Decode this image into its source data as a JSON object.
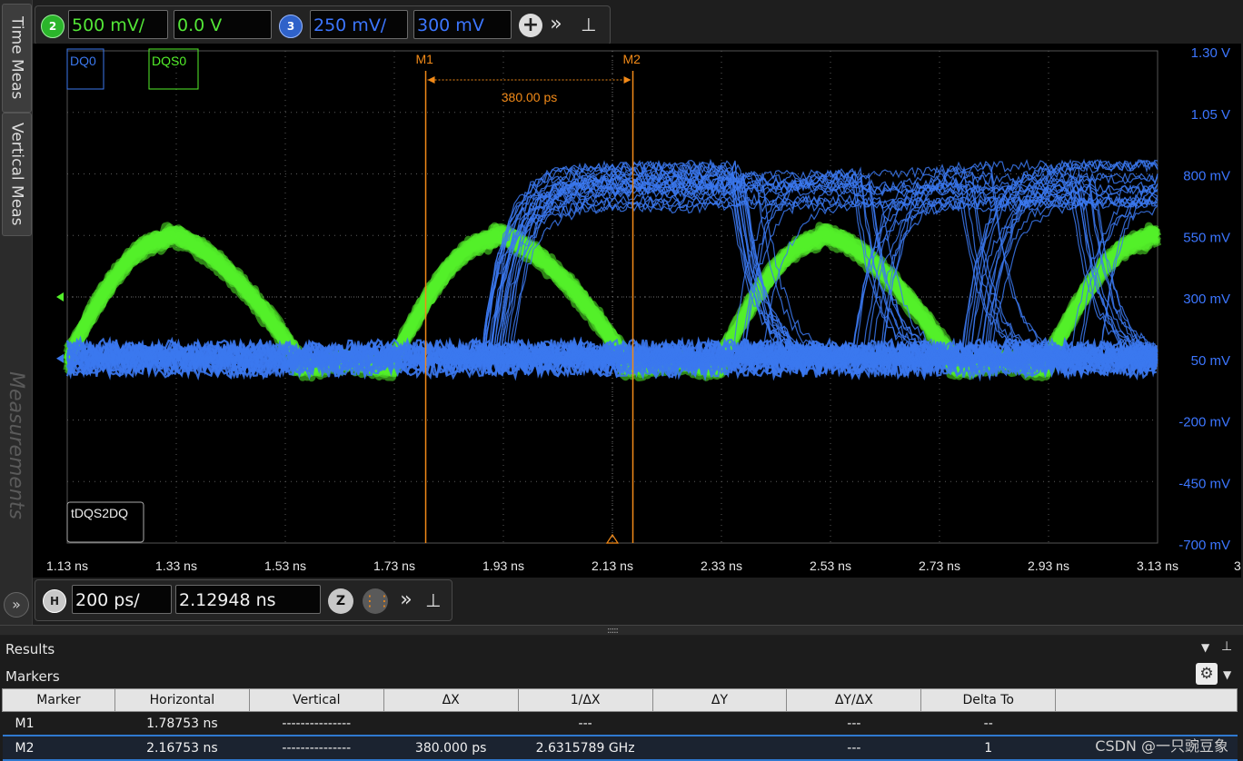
{
  "left_tabs": [
    "Time Meas",
    "Vertical Meas",
    "Measurements"
  ],
  "channel_toolbar": {
    "ch2_badge": "2",
    "ch2_scale": "500 mV/",
    "ch2_offset": "0.0 V",
    "ch3_badge": "3",
    "ch3_scale": "250 mV/",
    "ch3_offset": "300 mV"
  },
  "timebase_toolbar": {
    "h_badge": "H",
    "scale": "200 ps/",
    "position": "2.12948 ns"
  },
  "chart_data": {
    "type": "line",
    "title": "",
    "traces": [
      {
        "name": "DQ0",
        "color": "#3b78ee"
      },
      {
        "name": "DQS0",
        "color": "#53f02a"
      }
    ],
    "x_tick_labels": [
      "1.13 ns",
      "1.33 ns",
      "1.53 ns",
      "1.73 ns",
      "1.93 ns",
      "2.13 ns",
      "2.33 ns",
      "2.53 ns",
      "2.73 ns",
      "2.93 ns",
      "3.13 ns",
      "3"
    ],
    "y_tick_labels": [
      "1.30 V",
      "1.05 V",
      "800 mV",
      "550 mV",
      "300 mV",
      "50 mV",
      "-200 mV",
      "-450 mV",
      "-700 mV"
    ],
    "xlim_ns": [
      1.13,
      3.13
    ],
    "ylim_mV": [
      -700,
      1300
    ],
    "dqs0_crossings_ns": [
      1.13,
      1.55,
      1.73,
      2.15,
      2.33,
      2.75,
      2.93
    ],
    "dqs0_high_level_mV": 550,
    "dqs0_low_level_mV": 50,
    "dq0_baseline_mV": 50,
    "dq0_high_level_mV": 750,
    "markers": [
      {
        "name": "M1",
        "x_ns": 1.78753
      },
      {
        "name": "M2",
        "x_ns": 2.16753
      }
    ],
    "marker_delta_label": "380.00 ps",
    "measurement_label": "tDQS2DQ",
    "grid": true
  },
  "results": {
    "title": "Results",
    "section": "Markers",
    "columns": [
      "Marker",
      "Horizontal",
      "Vertical",
      "ΔX",
      "1/ΔX",
      "ΔY",
      "ΔY/ΔX",
      "Delta To",
      ""
    ],
    "rows": [
      [
        "M1",
        "1.78753 ns",
        "---------------",
        "",
        "---",
        "",
        "---",
        "--",
        ""
      ],
      [
        "M2",
        "2.16753 ns",
        "---------------",
        "380.000 ps",
        "2.6315789 GHz",
        "",
        "---",
        "1",
        ""
      ]
    ]
  },
  "watermark": "CSDN @一只豌豆象"
}
